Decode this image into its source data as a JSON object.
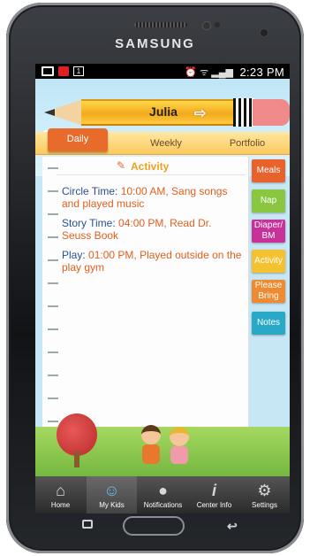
{
  "device": {
    "brand": "SAMSUNG"
  },
  "status_bar": {
    "time": "2:23 PM",
    "signal_icons": "⏰ ᯤ ▂▄▆"
  },
  "header": {
    "child_name": "Julia",
    "switch_icon": "arrow-right-icon"
  },
  "tabs": [
    {
      "label": "Daily",
      "active": true
    },
    {
      "label": "Weekly",
      "active": false
    },
    {
      "label": "Portfolio",
      "active": false
    }
  ],
  "activity": {
    "title": "Activity",
    "entries": [
      {
        "label": "Circle Time:",
        "value": "10:00 AM, Sang songs and played music"
      },
      {
        "label": "Story Time:",
        "value": "04:00 PM, Read Dr. Seuss Book"
      },
      {
        "label": "Play:",
        "value": "01:00 PM, Played outside on the play gym"
      }
    ]
  },
  "side_buttons": [
    {
      "label": "Meals",
      "color": "#e8632c"
    },
    {
      "label": "Nap",
      "color": "#8ac640"
    },
    {
      "label": "Diaper/ BM",
      "color": "#c8309a"
    },
    {
      "label": "Activity",
      "color": "#f4c230"
    },
    {
      "label": "Please Bring",
      "color": "#f08a30"
    },
    {
      "label": "Notes",
      "color": "#2aa8c8"
    }
  ],
  "bottom_nav": [
    {
      "label": "Home",
      "icon": "home-icon"
    },
    {
      "label": "My Kids",
      "icon": "kids-icon"
    },
    {
      "label": "Notifications",
      "icon": "chat-bubble-icon"
    },
    {
      "label": "Center Info",
      "icon": "info-icon"
    },
    {
      "label": "Settings",
      "icon": "gear-icon"
    }
  ]
}
